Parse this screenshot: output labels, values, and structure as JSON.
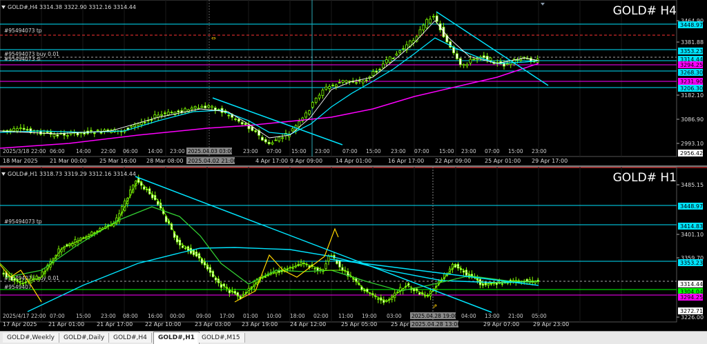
{
  "h4": {
    "header": "GOLD#,H4  3314.38 3322.90 3312.16 3314.44",
    "title": "GOLD# H4",
    "price_scale": [
      "3464.90",
      "3381.88",
      "3182.10",
      "3086.90",
      "2993.10"
    ],
    "level_badges": [
      {
        "label": "3448.97",
        "color": "#00e5ff"
      },
      {
        "label": "3353.23",
        "color": "#00e5ff"
      },
      {
        "label": "3314.44",
        "color": "#00e5ff"
      },
      {
        "label": "3294.25",
        "color": "#ff00ff"
      },
      {
        "label": "3268.30",
        "color": "#00e5ff"
      },
      {
        "label": "3231.90",
        "color": "#ff00ff"
      },
      {
        "label": "3206.30",
        "color": "#00e5ff"
      },
      {
        "label": "2956.42",
        "color": "#ffffff"
      }
    ],
    "line_labels": [
      "#95494073 tp",
      "#95494073 buy 0.01",
      "#95494073 sl"
    ],
    "time_axis": [
      "18 Mar 2025",
      "21 Mar 00:00",
      "25 Mar 16:00",
      "28 Mar 08:00",
      "2025.04.02 21:00",
      "4 Apr 17:00",
      "9 Apr 09:00",
      "14 Apr 01:00",
      "16 Apr 17:00",
      "22 Apr 09:00",
      "25 Apr 01:00",
      "29 Apr 17:00"
    ],
    "inner_times": [
      "2025/3/18 22:00",
      "06:00",
      "14:00",
      "22:00",
      "06:00",
      "14:00",
      "23:00",
      "2025.04.03 03:00",
      "23:00",
      "07:00",
      "15:00",
      "23:00",
      "07:00",
      "15:00",
      "23:00",
      "07:00",
      "15:00",
      "23:00",
      "07:00",
      "15:00",
      "23:00"
    ]
  },
  "h1": {
    "header": "GOLD#,H1  3318.73 3319.29 3312.16 3314.44",
    "title": "GOLD# H1",
    "price_scale": [
      "3485.15",
      "3401.10",
      "3359.70",
      "3226.00"
    ],
    "level_badges": [
      {
        "label": "3448.97",
        "color": "#00e5ff"
      },
      {
        "label": "3414.83",
        "color": "#00e5ff"
      },
      {
        "label": "3353.23",
        "color": "#00e5ff"
      },
      {
        "label": "3314.44",
        "color": "#ffffff"
      },
      {
        "label": "3304.04",
        "color": "#00ff00"
      },
      {
        "label": "3294.25",
        "color": "#ff00ff"
      },
      {
        "label": "3272.71",
        "color": "#ffffff"
      }
    ],
    "line_labels": [
      "#95494073 tp",
      "#95494073 buy 0.01",
      "#9549407"
    ],
    "time_axis": [
      "17 Apr 2025",
      "21 Apr 01:00",
      "21 Apr 17:00",
      "22 Apr 10:00",
      "23 Apr 03:00",
      "23 Apr 19:00",
      "24 Apr 12:00",
      "25 Apr 05:00",
      "25 Apr 21:00",
      "2025.04.28 13:00",
      "29 Apr 07:00",
      "29 Apr 23:00"
    ],
    "inner_times": [
      "2025/4/17 22:00",
      "07:00",
      "15:00",
      "23:00",
      "08:00",
      "16:00",
      "00:00",
      "09:00",
      "17:00",
      "01:00",
      "10:00",
      "18:00",
      "02:00",
      "11:00",
      "19:00",
      "03:00",
      "2025.04.28 19:00",
      "04:00",
      "13:00",
      "21:00",
      "05:00"
    ]
  },
  "tabs": [
    "GOLD#,Weekly",
    "GOLD#,Daily",
    "GOLD#,H4",
    "GOLD#,H1",
    "GOLD#,M15"
  ],
  "active_tab": "GOLD#,H1"
}
